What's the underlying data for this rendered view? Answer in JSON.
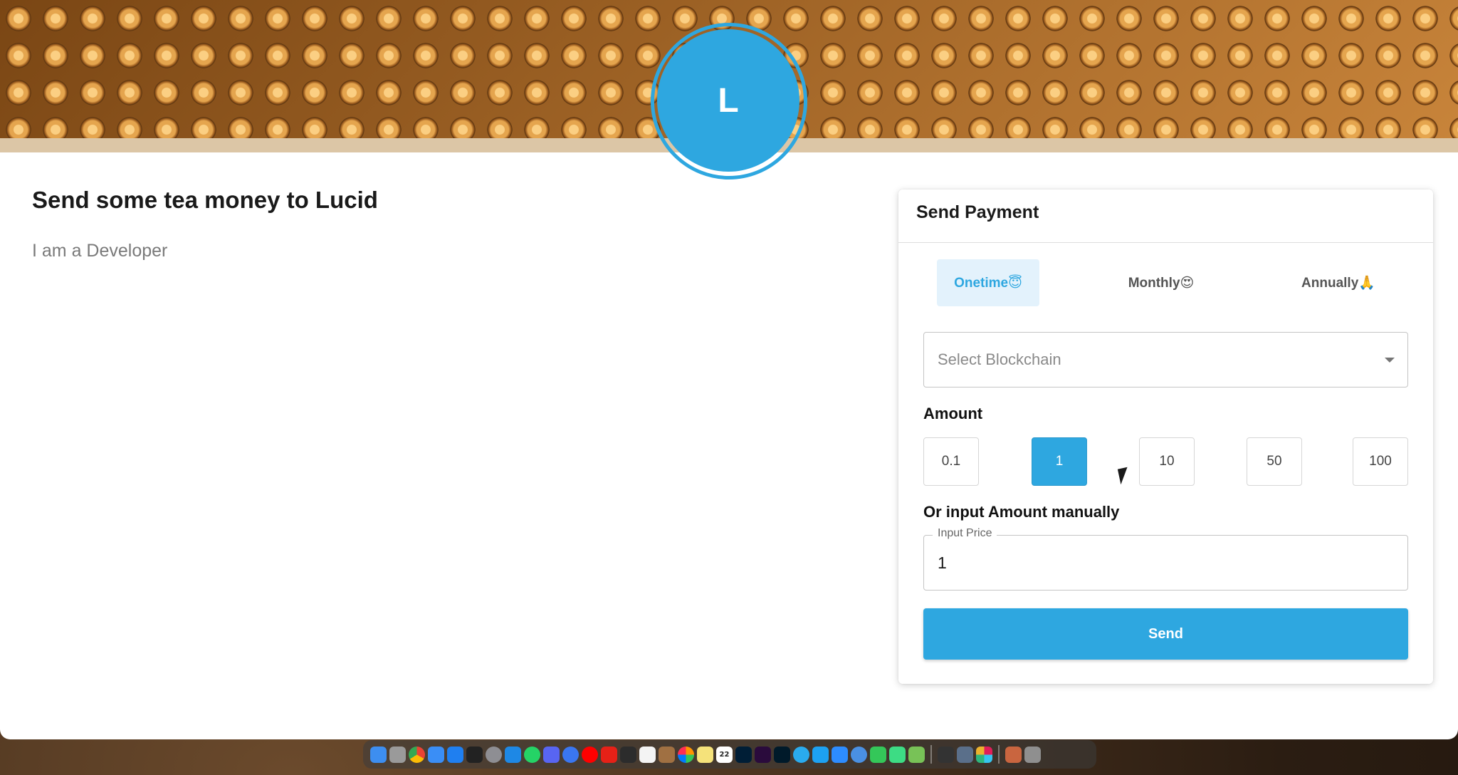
{
  "profile": {
    "avatar_initial": "L",
    "title": "Send some tea money to Lucid",
    "subtitle": "I am a Developer"
  },
  "payment_card": {
    "title": "Send Payment",
    "tabs": [
      {
        "label": "Onetime😇",
        "active": true
      },
      {
        "label": "Monthly😍",
        "active": false
      },
      {
        "label": "Annually🙏",
        "active": false
      }
    ],
    "blockchain_select": {
      "placeholder": "Select Blockchain"
    },
    "amount_label": "Amount",
    "amount_options": [
      "0.1",
      "1",
      "10",
      "50",
      "100"
    ],
    "selected_amount": "1",
    "manual_label": "Or input Amount manually",
    "price_field": {
      "label": "Input Price",
      "value": "1"
    },
    "send_label": "Send"
  },
  "colors": {
    "accent": "#2ea7e0",
    "active_tab_bg": "#e3f2fc",
    "banner_strip": "#dcc6a6"
  },
  "dock": {
    "icons": [
      "finder-icon",
      "launchpad-icon",
      "chrome-icon",
      "mail-icon",
      "app-store-icon",
      "terminal-icon",
      "settings-icon",
      "vscode-icon",
      "whatsapp-icon",
      "discord-icon",
      "signal-icon",
      "youtube-music-icon",
      "youtube-icon",
      "figma-icon",
      "wps-icon",
      "archive-icon",
      "photos-icon",
      "notes-icon",
      "calendar-icon",
      "photoshop-icon",
      "premiere-icon",
      "lightroom-icon",
      "telegram-icon",
      "twitter-icon",
      "zoom-icon",
      "vpn-icon",
      "messages-icon",
      "android-studio-icon",
      "android-icon",
      "activity-icon",
      "screens-icon",
      "slack-icon",
      "preview-icon",
      "trash-icon"
    ],
    "calendar_day": "22"
  }
}
